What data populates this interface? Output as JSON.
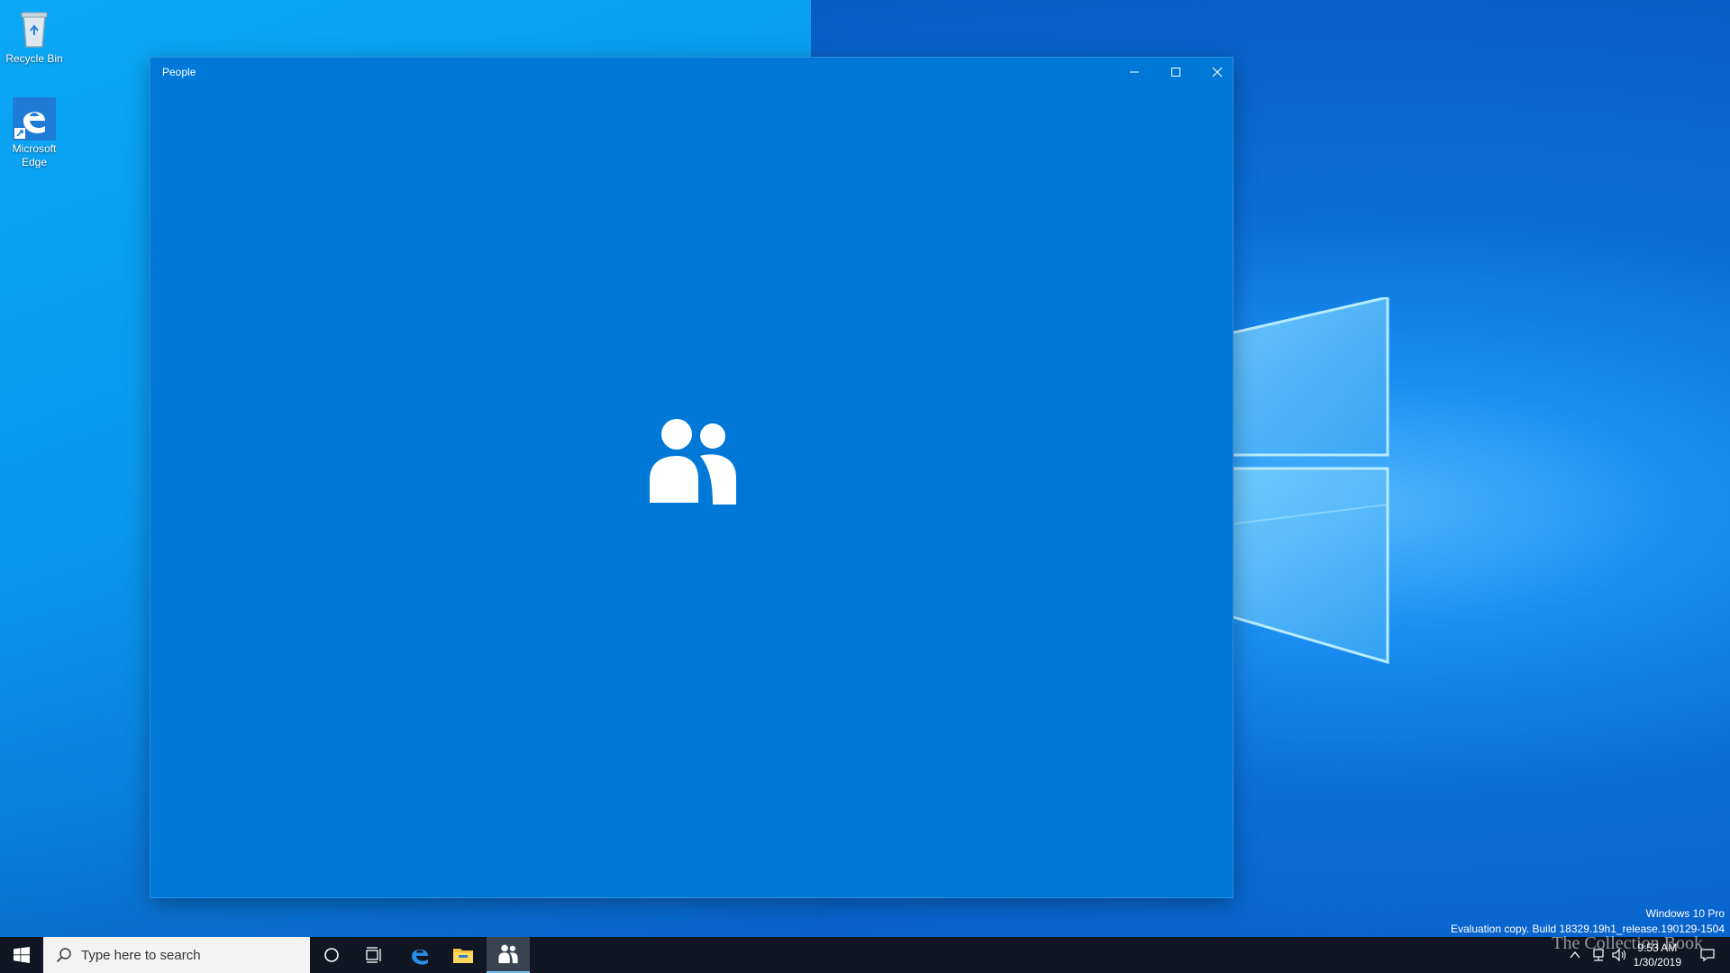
{
  "desktop": {
    "icons": [
      {
        "label": "Recycle Bin",
        "icon": "recycle-bin-icon"
      },
      {
        "label": "Microsoft Edge",
        "icon": "edge-icon"
      }
    ]
  },
  "window": {
    "title": "People",
    "accent": "#0078d7",
    "splash_icon": "people-icon",
    "controls": [
      "minimize-icon",
      "maximize-icon",
      "close-icon"
    ]
  },
  "watermark": {
    "edition": "Windows 10 Pro",
    "build": "Evaluation copy. Build 18329.19h1_release.190129-1504"
  },
  "taskbar": {
    "search_placeholder": "Type here to search",
    "pinned": [
      "cortana-icon",
      "task-view-icon",
      "edge-icon",
      "file-explorer-icon",
      "people-icon"
    ],
    "active_app": "People",
    "clock": {
      "time": "9:53 AM",
      "date": "1/30/2019"
    },
    "overlay_text": "The Collection Book"
  }
}
